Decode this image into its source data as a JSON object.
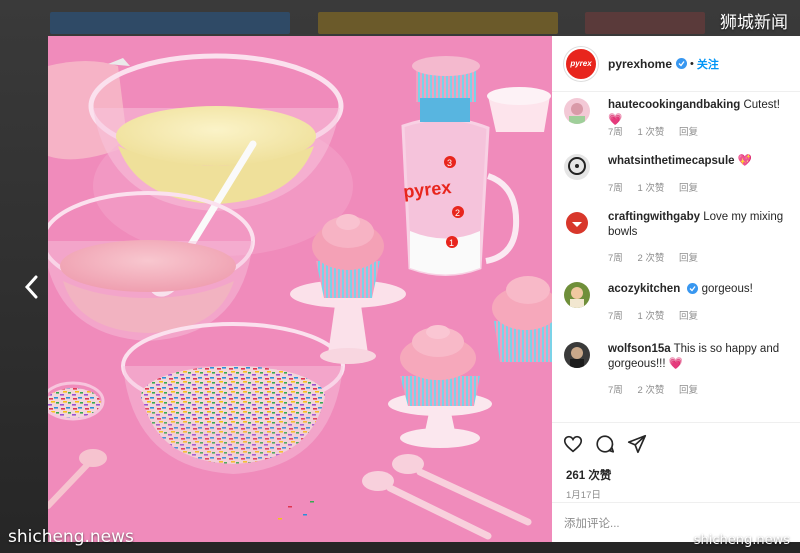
{
  "watermarks": {
    "top_right": "狮城新闻",
    "bottom_left": "shicheng.news",
    "bottom_right": "shicheng.news"
  },
  "post": {
    "account": "pyrexhome",
    "logo_text": "pyrex",
    "separator": "•",
    "follow_label": "关注",
    "likes": "261 次赞",
    "date": "1月17日",
    "add_comment_placeholder": "添加评论..."
  },
  "comments": [
    {
      "user": "hautecookingandbaking",
      "text": "Cutest!",
      "emoji": "💗",
      "verified": false,
      "age": "7周",
      "likes": "1 次赞",
      "reply": "回复"
    },
    {
      "user": "whatsinthetimecapsule",
      "text": "",
      "emoji": "💖",
      "verified": false,
      "age": "7周",
      "likes": "1 次赞",
      "reply": "回复"
    },
    {
      "user": "craftingwithgaby",
      "text": "Love my mixing bowls",
      "emoji": "",
      "verified": false,
      "age": "7周",
      "likes": "2 次赞",
      "reply": "回复"
    },
    {
      "user": "acozykitchen",
      "text": "gorgeous!",
      "emoji": "",
      "verified": true,
      "age": "7周",
      "likes": "1 次赞",
      "reply": "回复"
    },
    {
      "user": "wolfson15a",
      "text": "This is so happy and gorgeous!!!",
      "emoji": "💗",
      "verified": false,
      "age": "7周",
      "likes": "2 次赞",
      "reply": "回复"
    }
  ],
  "icons": {
    "prev": "chevron-left-icon",
    "like": "heart-icon",
    "comment": "comment-icon",
    "share": "paper-plane-icon",
    "verified": "verified-badge-icon"
  },
  "colors": {
    "brand_red": "#e8251d",
    "link_blue": "#0095f6",
    "verified_blue": "#3897f0",
    "photo_pink": "#ef86b8"
  },
  "photo_text": {
    "cup_brand": "pyrex",
    "cup_marks": [
      "1",
      "2",
      "3"
    ]
  }
}
